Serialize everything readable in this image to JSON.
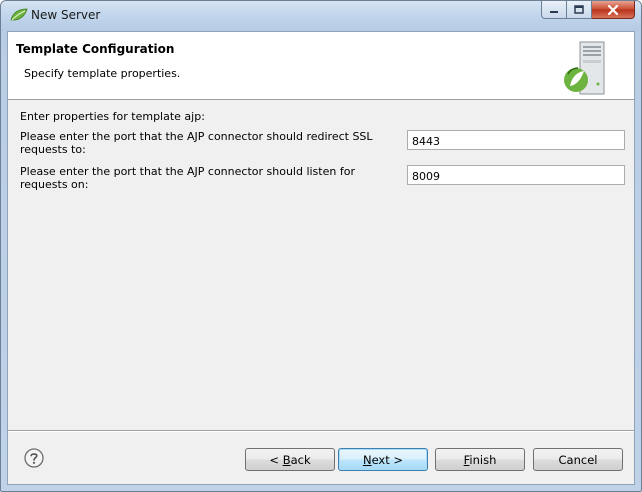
{
  "window": {
    "title": "New Server",
    "icon": "spring-leaf-icon",
    "controls": [
      "minimize-icon",
      "maximize-icon",
      "close-icon"
    ]
  },
  "header": {
    "title": "Template Configuration",
    "description": "Specify template properties.",
    "image": "server-icon"
  },
  "form": {
    "intro": "Enter properties for template ajp:",
    "fields": [
      {
        "label": "Please enter the port that the AJP connector should redirect SSL requests to:",
        "value": "8443"
      },
      {
        "label": "Please enter the port that the AJP connector should listen for requests on:",
        "value": "8009"
      }
    ]
  },
  "footer": {
    "help_icon": "help-icon",
    "buttons": {
      "back": {
        "pre": "< ",
        "mnemonic": "B",
        "post": "ack"
      },
      "next": {
        "pre": "",
        "mnemonic": "N",
        "post": "ext >"
      },
      "finish": {
        "pre": "",
        "mnemonic": "F",
        "post": "inish"
      },
      "cancel": {
        "pre": "Cancel",
        "mnemonic": "",
        "post": ""
      }
    }
  }
}
